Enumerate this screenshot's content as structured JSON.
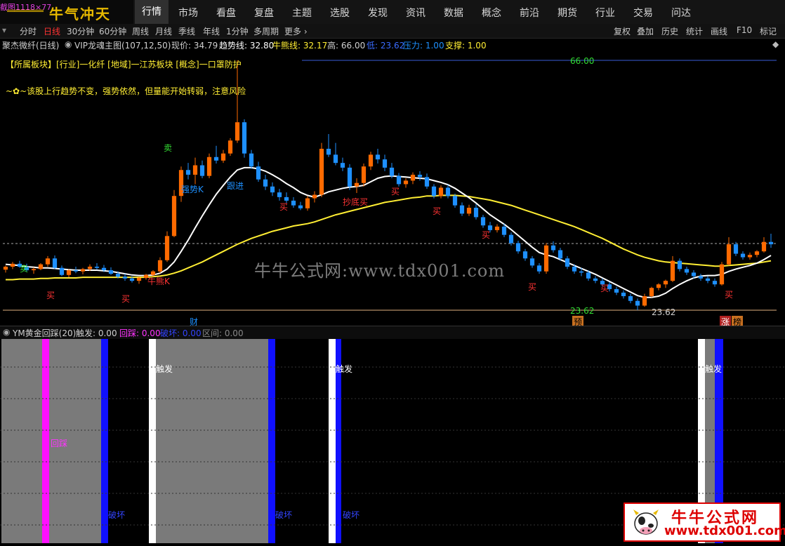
{
  "topbar": {
    "chip": "截图1118×77",
    "logo": "牛气冲天",
    "nav": [
      "行情",
      "市场",
      "看盘",
      "复盘",
      "主题",
      "选股",
      "发现",
      "资讯",
      "数据",
      "概念",
      "前沿",
      "期货",
      "行业",
      "交易",
      "问达"
    ],
    "active_nav": "行情"
  },
  "periods": {
    "left": [
      "分时",
      "日线",
      "30分钟",
      "60分钟",
      "周线",
      "月线",
      "季线",
      "年线",
      "1分钟",
      "多周期",
      "更多"
    ],
    "selected": "日线",
    "right": [
      "复权",
      "叠加",
      "历史",
      "统计",
      "画线",
      "F10",
      "标记"
    ]
  },
  "info": {
    "stock": "聚杰微纤(日线)",
    "indicator": "VIP龙魂主图(107,12,50)",
    "price": "现价: 34.79",
    "trend": "趋势线: 32.80",
    "bull": "牛熊线: 32.17",
    "high": "高: 66.00",
    "low": "低: 23.62",
    "pressure": "压力: 1.00",
    "support": "支撑: 1.00"
  },
  "annotations": {
    "sector": "【所属板块】[行业]一化纤 [地域]一江苏板块 [概念]一口罩防护",
    "comment": "~✿~该股上行趋势不变，强势依然，但量能开始转弱，注意风险",
    "high_label": "66.00",
    "low_label_1": "23.62",
    "low_label_2": "23.62",
    "cai": "财",
    "yu": "预",
    "zhang": "涨",
    "bang": "榜",
    "buy": "买",
    "sell": "卖",
    "bottom_buy": "抄底买",
    "bull_k": "牛熊K",
    "strong_k": "强势K",
    "follow": "跟进"
  },
  "subpanel": {
    "title": "YM黄金回踩(20)",
    "trigger": "触发: 0.00",
    "pullback": "回踩: 0.00",
    "break": "破坏: 0.00",
    "range": "区间: 0.00",
    "label_trigger": "触发",
    "label_pullback": "回踩",
    "label_break": "破坏"
  },
  "watermark": "牛牛公式网:www.tdx001.com",
  "brand": {
    "name": "牛牛公式网",
    "url": "www.tdx001.com"
  },
  "colors": {
    "up": "#ff6a00",
    "down": "#1e90ff",
    "ma_white": "#ffffff",
    "ma_yellow": "#ffee33",
    "accent_red": "#ff3333"
  },
  "chart_data": {
    "type": "candlestick",
    "ylim": [
      23.62,
      66.0
    ],
    "high_line": 66.0,
    "low_line": 23.62,
    "candles": [
      [
        30.5,
        31.2,
        30.0,
        31.0
      ],
      [
        31.0,
        31.8,
        30.6,
        31.5
      ],
      [
        31.5,
        32.0,
        30.8,
        31.0
      ],
      [
        31.0,
        31.5,
        30.2,
        30.4
      ],
      [
        30.4,
        30.9,
        29.8,
        30.6
      ],
      [
        30.6,
        31.6,
        30.4,
        31.4
      ],
      [
        31.4,
        32.8,
        31.0,
        32.4
      ],
      [
        32.4,
        32.9,
        30.6,
        30.8
      ],
      [
        30.8,
        31.2,
        29.4,
        29.6
      ],
      [
        29.6,
        30.6,
        29.2,
        30.4
      ],
      [
        30.4,
        31.0,
        29.9,
        30.2
      ],
      [
        30.2,
        30.8,
        29.7,
        30.6
      ],
      [
        30.6,
        31.4,
        30.3,
        31.0
      ],
      [
        31.0,
        31.6,
        30.5,
        30.8
      ],
      [
        30.8,
        31.3,
        30.1,
        30.4
      ],
      [
        30.4,
        30.9,
        29.6,
        29.8
      ],
      [
        29.8,
        30.2,
        29.0,
        29.3
      ],
      [
        29.3,
        29.8,
        28.6,
        29.0
      ],
      [
        29.0,
        29.4,
        28.3,
        28.6
      ],
      [
        28.6,
        29.3,
        28.1,
        29.1
      ],
      [
        29.1,
        29.8,
        28.8,
        29.6
      ],
      [
        29.6,
        30.4,
        29.3,
        30.2
      ],
      [
        30.2,
        32.6,
        29.9,
        32.1
      ],
      [
        32.1,
        37.0,
        31.8,
        36.2
      ],
      [
        36.2,
        44.0,
        36.0,
        43.0
      ],
      [
        43.0,
        48.0,
        42.0,
        47.4
      ],
      [
        47.4,
        48.6,
        45.8,
        46.6
      ],
      [
        46.6,
        49.5,
        45.0,
        48.2
      ],
      [
        48.2,
        49.0,
        46.0,
        46.4
      ],
      [
        46.4,
        50.2,
        46.0,
        49.6
      ],
      [
        49.6,
        51.5,
        48.5,
        49.0
      ],
      [
        49.0,
        50.8,
        48.6,
        50.2
      ],
      [
        50.2,
        52.8,
        49.8,
        52.4
      ],
      [
        52.4,
        66.0,
        52.0,
        55.5
      ],
      [
        55.5,
        56.0,
        49.5,
        50.2
      ],
      [
        50.2,
        50.8,
        47.6,
        48.0
      ],
      [
        48.0,
        48.8,
        45.4,
        45.8
      ],
      [
        45.8,
        46.6,
        44.0,
        44.6
      ],
      [
        44.6,
        45.3,
        43.0,
        43.6
      ],
      [
        43.6,
        44.2,
        42.2,
        42.8
      ],
      [
        42.8,
        43.6,
        41.8,
        42.2
      ],
      [
        42.2,
        42.8,
        41.0,
        41.4
      ],
      [
        41.4,
        42.0,
        40.6,
        40.9
      ],
      [
        40.9,
        43.0,
        40.5,
        42.6
      ],
      [
        42.6,
        43.8,
        41.9,
        43.2
      ],
      [
        43.2,
        52.0,
        42.8,
        51.0
      ],
      [
        51.0,
        53.5,
        49.6,
        50.0
      ],
      [
        50.0,
        52.0,
        48.2,
        48.6
      ],
      [
        48.6,
        49.5,
        47.2,
        47.8
      ],
      [
        47.8,
        48.4,
        44.0,
        44.6
      ],
      [
        44.6,
        46.0,
        43.5,
        45.2
      ],
      [
        45.2,
        48.5,
        44.6,
        48.0
      ],
      [
        48.0,
        50.5,
        47.4,
        50.0
      ],
      [
        50.0,
        51.0,
        48.5,
        49.2
      ],
      [
        49.2,
        50.0,
        47.2,
        47.8
      ],
      [
        47.8,
        48.6,
        46.0,
        46.4
      ],
      [
        46.4,
        46.9,
        44.6,
        45.0
      ],
      [
        45.0,
        46.0,
        44.4,
        45.6
      ],
      [
        45.6,
        47.0,
        45.0,
        46.6
      ],
      [
        46.6,
        47.2,
        45.6,
        46.2
      ],
      [
        46.2,
        46.8,
        44.2,
        44.6
      ],
      [
        44.6,
        45.0,
        42.6,
        43.0
      ],
      [
        43.0,
        44.8,
        42.6,
        44.4
      ],
      [
        44.4,
        44.9,
        42.6,
        43.0
      ],
      [
        43.0,
        43.4,
        41.0,
        41.4
      ],
      [
        41.4,
        41.9,
        39.6,
        40.0
      ],
      [
        40.0,
        41.5,
        39.6,
        41.0
      ],
      [
        41.0,
        41.6,
        39.0,
        39.4
      ],
      [
        39.4,
        39.8,
        37.6,
        38.0
      ],
      [
        38.0,
        38.6,
        36.8,
        37.2
      ],
      [
        37.2,
        38.2,
        36.8,
        37.8
      ],
      [
        37.8,
        38.3,
        36.0,
        36.4
      ],
      [
        36.4,
        36.8,
        34.6,
        35.0
      ],
      [
        35.0,
        35.4,
        33.2,
        33.6
      ],
      [
        33.6,
        34.0,
        32.0,
        32.4
      ],
      [
        32.4,
        32.8,
        30.8,
        31.2
      ],
      [
        31.2,
        31.6,
        29.8,
        30.2
      ],
      [
        30.2,
        35.0,
        29.8,
        34.6
      ],
      [
        34.6,
        35.3,
        33.4,
        33.8
      ],
      [
        33.8,
        34.2,
        32.0,
        32.4
      ],
      [
        32.4,
        32.8,
        30.6,
        31.0
      ],
      [
        31.0,
        31.4,
        29.8,
        30.2
      ],
      [
        30.2,
        30.8,
        29.4,
        30.0
      ],
      [
        30.0,
        30.4,
        28.6,
        29.0
      ],
      [
        29.0,
        29.4,
        28.2,
        28.6
      ],
      [
        28.6,
        29.0,
        27.6,
        28.0
      ],
      [
        28.0,
        28.4,
        26.8,
        27.2
      ],
      [
        27.2,
        27.6,
        26.2,
        26.6
      ],
      [
        26.6,
        27.0,
        25.6,
        26.0
      ],
      [
        26.0,
        26.4,
        24.8,
        25.2
      ],
      [
        25.2,
        25.6,
        23.62,
        24.4
      ],
      [
        24.4,
        26.4,
        24.2,
        26.0
      ],
      [
        26.0,
        27.6,
        25.8,
        27.4
      ],
      [
        27.4,
        28.2,
        27.0,
        28.0
      ],
      [
        28.0,
        28.8,
        27.4,
        28.6
      ],
      [
        28.6,
        32.8,
        28.4,
        32.0
      ],
      [
        32.0,
        32.4,
        30.2,
        30.6
      ],
      [
        30.6,
        31.0,
        29.6,
        30.0
      ],
      [
        30.0,
        30.4,
        29.0,
        29.4
      ],
      [
        29.4,
        29.8,
        28.6,
        29.0
      ],
      [
        29.0,
        29.4,
        28.2,
        28.6
      ],
      [
        28.6,
        29.0,
        27.6,
        28.0
      ],
      [
        28.0,
        31.8,
        27.8,
        31.4
      ],
      [
        31.4,
        36.0,
        31.2,
        34.8
      ],
      [
        34.8,
        35.2,
        32.8,
        33.2
      ],
      [
        33.2,
        33.6,
        32.2,
        32.6
      ],
      [
        32.6,
        33.4,
        32.2,
        33.0
      ],
      [
        33.0,
        33.8,
        32.6,
        33.6
      ],
      [
        33.6,
        36.0,
        33.4,
        35.2
      ],
      [
        35.2,
        36.6,
        34.2,
        34.8
      ]
    ],
    "ma_white": [
      31.4,
      31.3,
      31.2,
      31.0,
      30.9,
      30.8,
      30.8,
      30.7,
      30.6,
      30.5,
      30.4,
      30.4,
      30.4,
      30.4,
      30.3,
      30.2,
      30.0,
      29.8,
      29.6,
      29.5,
      29.5,
      29.6,
      29.9,
      30.6,
      31.8,
      33.6,
      35.5,
      37.6,
      39.6,
      41.5,
      43.3,
      44.8,
      46.2,
      47.4,
      47.8,
      47.8,
      47.6,
      47.2,
      46.6,
      45.9,
      45.1,
      44.4,
      43.6,
      43.1,
      42.8,
      43.2,
      43.7,
      44.0,
      44.3,
      44.5,
      44.6,
      44.8,
      45.4,
      46.0,
      46.3,
      46.4,
      46.3,
      46.2,
      46.1,
      46.0,
      45.9,
      45.6,
      45.3,
      44.9,
      44.3,
      43.5,
      42.7,
      41.8,
      40.8,
      39.8,
      39.0,
      38.2,
      37.3,
      36.3,
      35.3,
      34.3,
      33.4,
      33.0,
      32.7,
      32.2,
      31.7,
      31.2,
      30.7,
      30.2,
      29.7,
      29.1,
      28.5,
      27.9,
      27.3,
      26.7,
      26.1,
      25.8,
      25.8,
      26.0,
      26.5,
      27.3,
      28.0,
      28.6,
      29.1,
      29.4,
      29.5,
      29.5,
      29.7,
      30.2,
      30.6,
      30.9,
      31.2,
      31.6,
      32.2,
      32.9
    ],
    "ma_yellow": [
      28.8,
      28.8,
      28.9,
      28.9,
      28.9,
      29.0,
      29.0,
      29.1,
      29.1,
      29.1,
      29.1,
      29.2,
      29.2,
      29.2,
      29.2,
      29.2,
      29.2,
      29.2,
      29.2,
      29.2,
      29.2,
      29.3,
      29.4,
      29.6,
      29.9,
      30.3,
      30.8,
      31.3,
      31.8,
      32.4,
      33.0,
      33.6,
      34.2,
      34.8,
      35.3,
      35.8,
      36.2,
      36.6,
      37.0,
      37.3,
      37.6,
      37.9,
      38.1,
      38.3,
      38.6,
      39.0,
      39.4,
      39.8,
      40.1,
      40.4,
      40.7,
      41.0,
      41.3,
      41.6,
      41.9,
      42.1,
      42.3,
      42.5,
      42.7,
      42.8,
      43.0,
      43.0,
      43.1,
      43.1,
      43.1,
      43.0,
      42.9,
      42.7,
      42.5,
      42.3,
      42.0,
      41.7,
      41.4,
      41.0,
      40.6,
      40.2,
      39.8,
      39.4,
      39.0,
      38.6,
      38.2,
      37.8,
      37.3,
      36.8,
      36.3,
      35.8,
      35.2,
      34.6,
      34.0,
      33.5,
      33.0,
      32.6,
      32.3,
      32.0,
      31.8,
      31.7,
      31.6,
      31.5,
      31.4,
      31.3,
      31.2,
      31.1,
      31.1,
      31.2,
      31.3,
      31.4,
      31.5,
      31.6,
      31.8,
      32.0
    ]
  }
}
